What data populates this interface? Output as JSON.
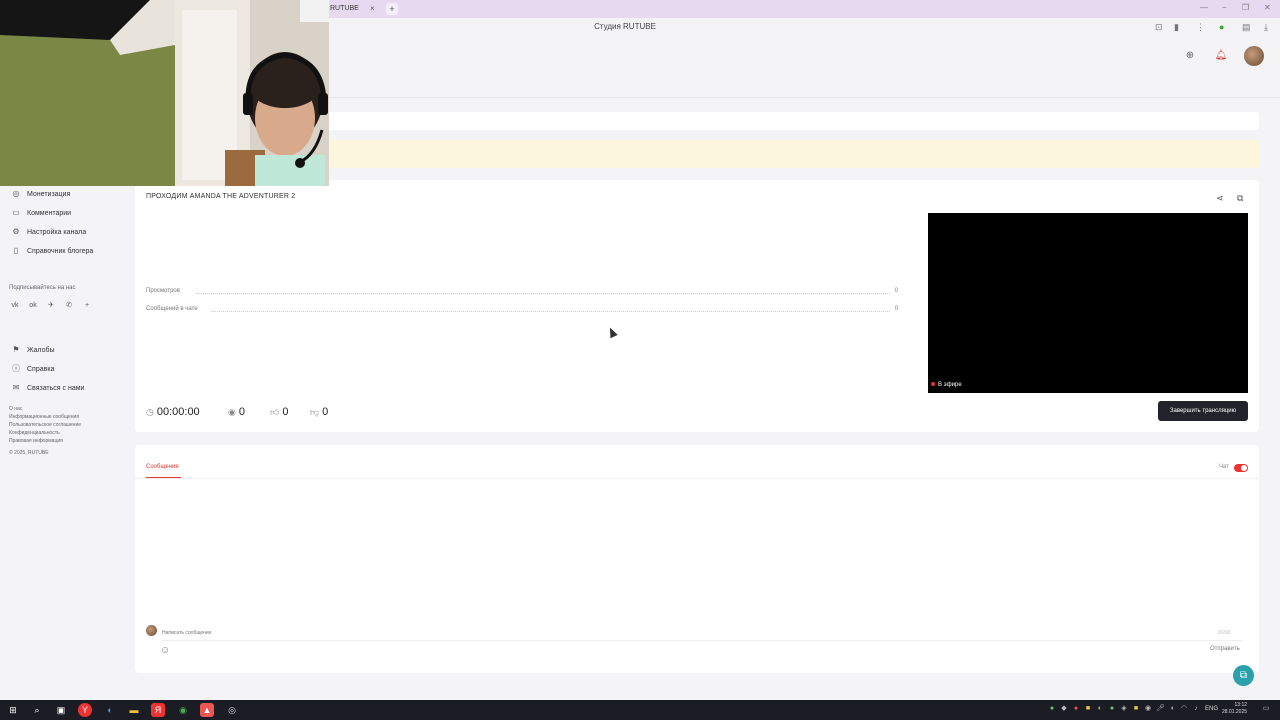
{
  "browser": {
    "tab_label": "RUTUBE",
    "tab_close": "×",
    "tab_add": "+",
    "page_title": "Студия RUTUBE",
    "window_controls": [
      "—",
      "−",
      "❐",
      "✕"
    ]
  },
  "sidebar": {
    "items": [
      {
        "label": "Монетизация",
        "icon": "coin-icon"
      },
      {
        "label": "Комментарии",
        "icon": "comment-icon"
      },
      {
        "label": "Настройка канала",
        "icon": "gear-icon"
      },
      {
        "label": "Справочник блогера",
        "icon": "book-icon"
      }
    ],
    "follow_label": "Подписывайтесь на нас",
    "socials": [
      "vk",
      "ok",
      "telegram",
      "viber",
      "+"
    ],
    "support": [
      {
        "label": "Жалобы",
        "icon": "flag-icon"
      },
      {
        "label": "Справка",
        "icon": "help-icon"
      },
      {
        "label": "Связаться с нами",
        "icon": "mail-icon"
      }
    ],
    "footer_links": [
      "О нас",
      "Информационные сообщения",
      "Пользовательское соглашение",
      "Конфиденциальность",
      "Правовая информация"
    ],
    "copyright": "© 2025, RUTUBE"
  },
  "stream": {
    "title": "ПРОХОДИМ AMANDA THE ADVENTURER 2",
    "stats": [
      {
        "label": "Просмотров",
        "value": "0"
      },
      {
        "label": "Сообщений в чате",
        "value": "0"
      }
    ],
    "live_label": "В эфире",
    "duration": "00:00:00",
    "viewers": "0",
    "likes": "0",
    "dislikes": "0",
    "end_button": "Завершить трансляцию"
  },
  "chat": {
    "tab": "Сообщения",
    "toggle_label": "Чат",
    "input_placeholder": "Написать сообщение",
    "char_count": "0/200",
    "send": "Отправить"
  },
  "taskbar": {
    "lang": "ENG",
    "time": "13:12",
    "date": "28.01.2025"
  },
  "colors": {
    "accent": "#e23a3a",
    "tab_bar": "#e7d9ef",
    "button_dark": "#23232b",
    "fab": "#2ba0ad"
  }
}
